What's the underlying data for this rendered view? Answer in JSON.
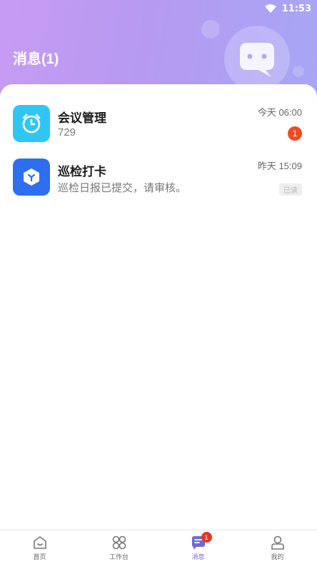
{
  "status_bar": {
    "time": "11:53",
    "wifi_icon": "wifi-icon"
  },
  "header": {
    "title": "消息(1)",
    "gradient_start": "#c79bf3",
    "gradient_end": "#a7a6f5",
    "illustration_icon": "chat-bubble-icon"
  },
  "messages": [
    {
      "title": "会议管理",
      "subtitle": "729",
      "time": "今天  06:00",
      "unread_count": "1",
      "icon": "alarm-clock-icon",
      "icon_color": "#2fc6f5"
    },
    {
      "title": "巡检打卡",
      "subtitle": "巡检日报已提交，请审核。",
      "time": "昨天  15:09",
      "read_label": "已读",
      "icon": "cube-icon",
      "icon_color": "#2e6ef0"
    }
  ],
  "tabbar": {
    "items": [
      {
        "label": "首页",
        "icon": "home-icon"
      },
      {
        "label": "工作台",
        "icon": "grid-icon"
      },
      {
        "label": "消息",
        "icon": "message-icon",
        "badge": "1",
        "active": true
      },
      {
        "label": "我的",
        "icon": "user-icon"
      }
    ],
    "accent": "#6b6bd6"
  }
}
